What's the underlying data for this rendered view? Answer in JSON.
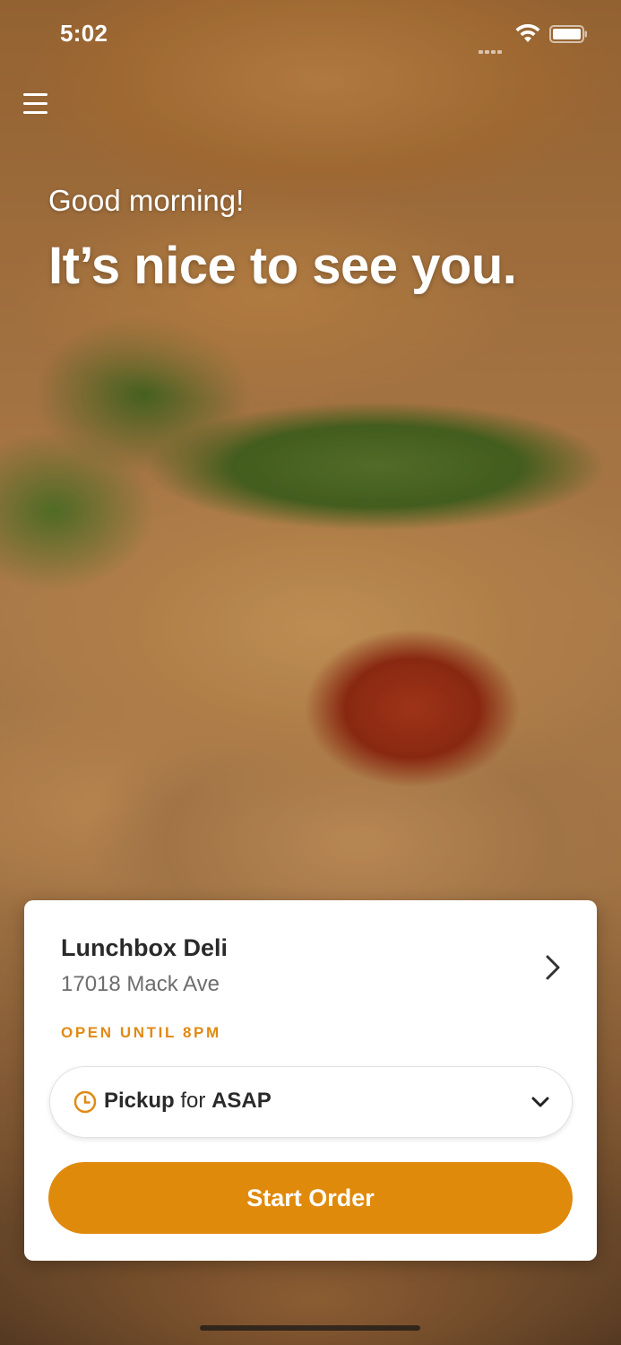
{
  "status_bar": {
    "time": "5:02",
    "icons": [
      "signal-icon",
      "wifi-icon",
      "battery-icon"
    ]
  },
  "header": {
    "menu_icon": "hamburger-menu-icon",
    "greeting": "Good morning!",
    "headline": "It’s nice to see you."
  },
  "store": {
    "name": "Lunchbox Deli",
    "address": "17018 Mack Ave",
    "status": "OPEN UNTIL 8PM",
    "status_color": "#e08a14"
  },
  "order": {
    "mode": "Pickup",
    "connector": "for",
    "time": "ASAP",
    "start_label": "Start Order",
    "accent_color": "#e08a0c"
  }
}
